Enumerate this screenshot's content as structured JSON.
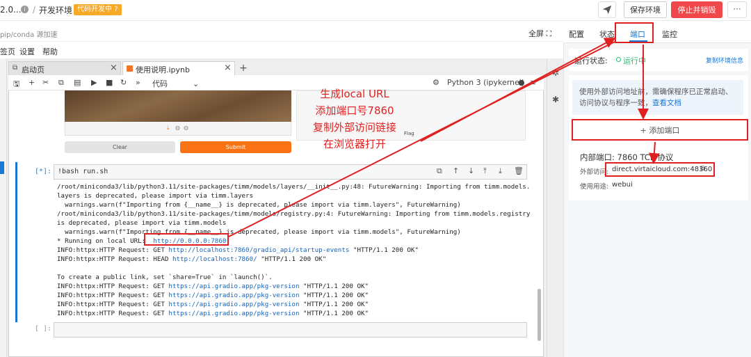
{
  "topbar": {
    "version": "2.0...",
    "slash": "/",
    "env_name": "开发环境",
    "badge": "代码开发中",
    "save_label": "保存环境",
    "stop_label": "停止并销毁",
    "more_label": "···"
  },
  "subbar": {
    "pip_text": "pip/conda 源加速",
    "fullscreen": "全屏"
  },
  "menu": [
    "签页",
    "设置",
    "帮助"
  ],
  "tabs": [
    {
      "label": "启动页",
      "close": "×"
    },
    {
      "label": "使用说明.ipynb",
      "close": "×"
    }
  ],
  "plus_tab": "+",
  "toolbar": {
    "cell_type": "代码",
    "kernel": "Python 3 (ipykernel)"
  },
  "gradio": {
    "clear": "Clear",
    "submit": "Submit",
    "flag": "Flag"
  },
  "cell": {
    "prompt": "[*]:",
    "code": "!bash run.sh",
    "empty_prompt": "[ ]:"
  },
  "output": {
    "l1": "/root/miniconda3/lib/python3.11/site-packages/timm/models/layers/__init__.py:48: FutureWarning: Importing from timm.models.",
    "l2": "layers is deprecated, please import via timm.layers",
    "l3": "  warnings.warn(f\"Importing from {__name__} is deprecated, please import via timm.layers\", FutureWarning)",
    "l4": "/root/miniconda3/lib/python3.11/site-packages/timm/models/registry.py:4: FutureWarning: Importing from timm.models.registry",
    "l5": "is deprecated, please import via timm.models",
    "l6": "  warnings.warn(f\"Importing from {__name__} is deprecated, please import via timm.models\", FutureWarning)",
    "l7_pre": "* Running on local URL:  ",
    "l7_link": "http://0.0.0.0:7860",
    "l8_pre": "INFO:httpx:HTTP Request: GET ",
    "l8_link": "http://localhost:7860/gradio_api/startup-events",
    "l8_post": " \"HTTP/1.1 200 OK\"",
    "l9_pre": "INFO:httpx:HTTP Request: HEAD ",
    "l9_link": "http://localhost:7860/",
    "l9_post": " \"HTTP/1.1 200 OK\"",
    "l10": "To create a public link, set `share=True` in `launch()`.",
    "req_pre": "INFO:httpx:HTTP Request: GET ",
    "req_link": "https://api.gradio.app/pkg-version",
    "req_post": " \"HTTP/1.1 200 OK\""
  },
  "annotation": [
    "生成local URL",
    "添加端口号7860",
    "复制外部访问链接",
    "在浏览器打开"
  ],
  "right_panel": {
    "tabs": [
      "配置",
      "状态",
      "端口",
      "监控"
    ],
    "status_label": "运行状态:",
    "status_value": "运行中",
    "copy_env": "复制环境信息",
    "tip": "使用外部访问地址前，需确保程序已正常启动、访问协议与程序一致，",
    "tip_link": "查看文档",
    "add_port": "+ 添加端口",
    "internal": "内部端口:  7860   TCP 协议",
    "ext_label": "外部访问:",
    "ext_url": "direct.virtaicloud.com:48360",
    "use_label": "使用用途:",
    "use_value": "webui"
  },
  "colors": {
    "accent": "#1976d2",
    "stop": "#f0474a",
    "badge": "#f7a928",
    "submit": "#f97316",
    "annotation": "#e02020",
    "running": "#2eb872"
  }
}
